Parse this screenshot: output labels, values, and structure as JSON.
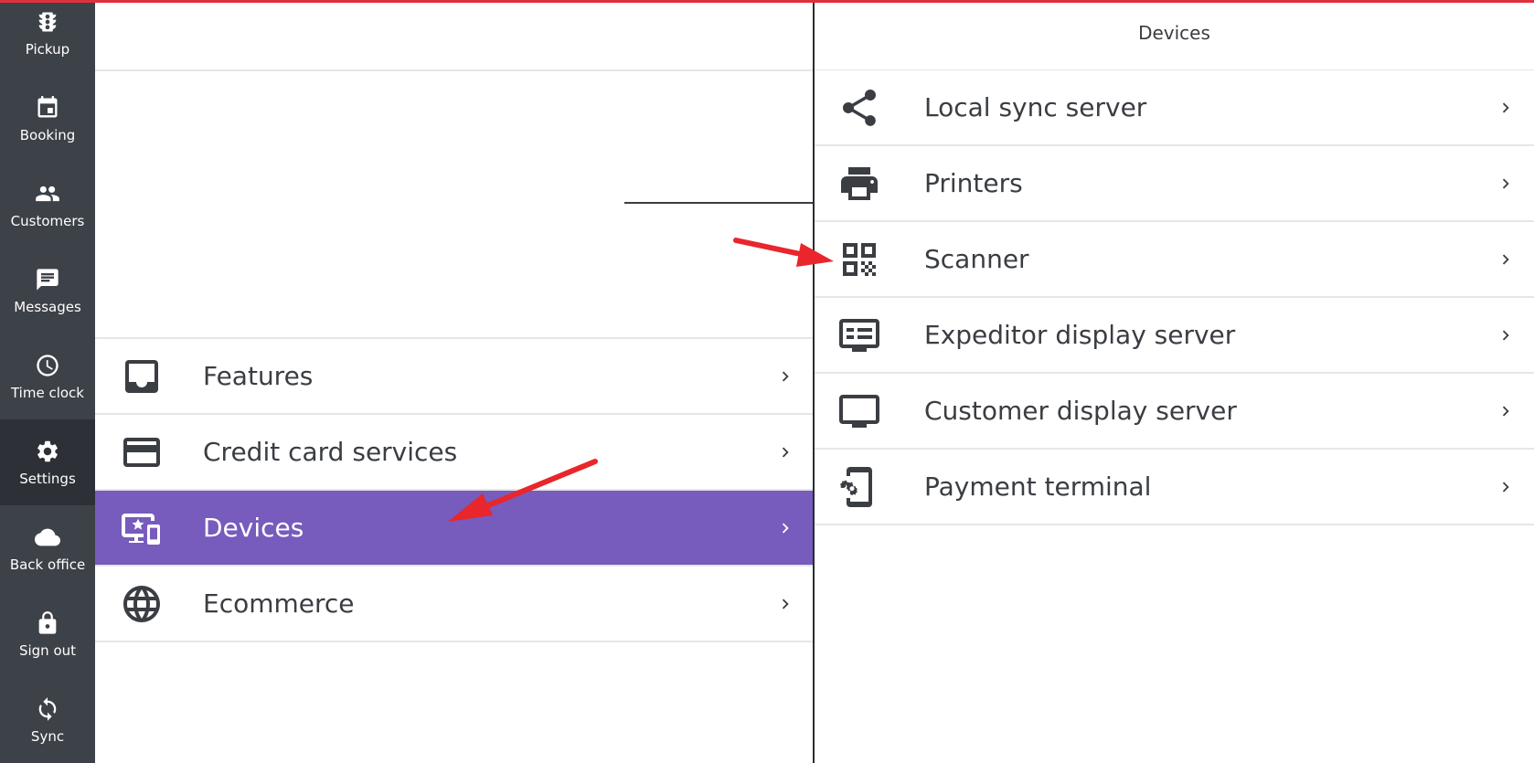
{
  "nav": {
    "items": [
      {
        "label": "Pickup",
        "icon": "traffic-light-icon"
      },
      {
        "label": "Booking",
        "icon": "calendar-icon"
      },
      {
        "label": "Customers",
        "icon": "people-icon"
      },
      {
        "label": "Messages",
        "icon": "message-icon"
      },
      {
        "label": "Time clock",
        "icon": "clock-icon"
      },
      {
        "label": "Settings",
        "icon": "gear-icon",
        "active": true
      },
      {
        "label": "Back office",
        "icon": "cloud-icon"
      },
      {
        "label": "Sign out",
        "icon": "lock-icon"
      },
      {
        "label": "Sync",
        "icon": "sync-icon"
      }
    ]
  },
  "settings_list": {
    "items": [
      {
        "label": "Features",
        "icon": "inbox-icon"
      },
      {
        "label": "Credit card services",
        "icon": "credit-card-icon"
      },
      {
        "label": "Devices",
        "icon": "devices-icon",
        "selected": true
      },
      {
        "label": "Ecommerce",
        "icon": "globe-icon"
      }
    ]
  },
  "devices_panel": {
    "title": "Devices",
    "items": [
      {
        "label": "Local sync server",
        "icon": "share-icon"
      },
      {
        "label": "Printers",
        "icon": "printer-icon"
      },
      {
        "label": "Scanner",
        "icon": "qr-code-icon"
      },
      {
        "label": "Expeditor display server",
        "icon": "list-display-icon"
      },
      {
        "label": "Customer display server",
        "icon": "monitor-icon"
      },
      {
        "label": "Payment terminal",
        "icon": "phone-settings-icon"
      }
    ]
  },
  "colors": {
    "nav_bg": "#3d4148",
    "nav_active": "#2d3036",
    "selected_row": "#775bbd",
    "annotation_arrow": "#e8262b",
    "top_strip": "#e0303b"
  }
}
